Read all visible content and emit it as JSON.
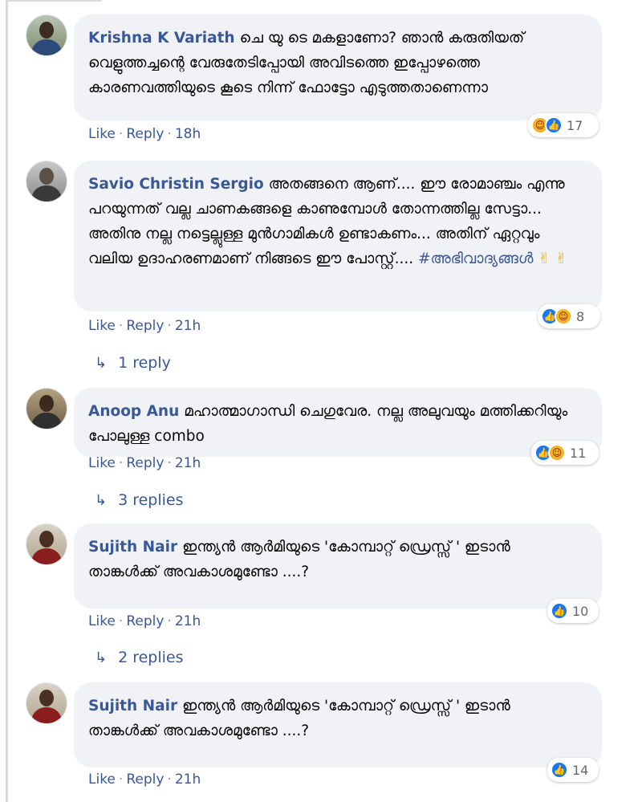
{
  "comments": [
    {
      "author": "Krishna K Variath",
      "text": "ചെ യു ടെ മകളാണോ? ഞാൻ കരുതിയത് വെളുത്തച്ചന്റെ വേരുതേടിപ്പോയി അവിടത്തെ ഇപ്പോഴത്തെ കാരണവത്തിയുടെ കൂടെ നിന്ന് ഫോട്ടോ എടുത്തതാണെന്നാ",
      "reactions": [
        "haha",
        "like"
      ],
      "reaction_count": "17",
      "like_label": "Like",
      "reply_label": "Reply",
      "time": "18h"
    },
    {
      "author": "Savio Christin Sergio",
      "text": "അതങ്ങനെ ആണ്.... ഈ രോമാഞ്ചം എന്നു പറയുന്നത് വല്ല ചാണകങ്ങളെ കാണുമ്പോൾ തോന്നത്തില്ല സേട്ടാ... അതിനു നല്ല നട്ടെല്ലുള്ള മുൻഗാമികൾ ഉണ്ടാകണം... അതിന് ഏറ്റവും വലിയ ഉദാഹരണമാണ് നിങ്ങടെ ഈ പോസ്റ്റ്....",
      "hashtag": "#അഭിവാദ്യങ്ങൾ",
      "emoji": "✌ ✌",
      "reactions": [
        "like",
        "haha"
      ],
      "reaction_count": "8",
      "like_label": "Like",
      "reply_label": "Reply",
      "time": "21h",
      "replies_label": "1 reply"
    },
    {
      "author": "Anoop Anu",
      "text": "മഹാത്മാഗാന്ധി ചെഗുവേര. നല്ല അലുവയും മത്തിക്കറിയും പോലുള്ള combo",
      "reactions": [
        "like",
        "haha"
      ],
      "reaction_count": "11",
      "like_label": "Like",
      "reply_label": "Reply",
      "time": "21h",
      "replies_label": "3 replies"
    },
    {
      "author": "Sujith Nair",
      "text": "ഇന്ത്യൻ ആർമിയുടെ 'കോമ്പാറ്റ് ഡ്രെസ്സ് ' ഇടാൻ താങ്കൾക്ക് അവകാശമുണ്ടോ ....?",
      "reactions": [
        "like"
      ],
      "reaction_count": "10",
      "like_label": "Like",
      "reply_label": "Reply",
      "time": "21h",
      "replies_label": "2 replies"
    },
    {
      "author": "Sujith Nair",
      "text": "ഇന്ത്യൻ ആർമിയുടെ 'കോമ്പാറ്റ് ഡ്രെസ്സ് ' ഇടാൻ താങ്കൾക്ക് അവകാശമുണ്ടോ ....?",
      "reactions": [
        "like"
      ],
      "reaction_count": "14",
      "like_label": "Like",
      "reply_label": "Reply",
      "time": "21h"
    }
  ],
  "icons": {
    "like": "like-reaction-icon",
    "haha": "haha-reaction-icon",
    "reply_arrow": "reply-arrow-icon"
  },
  "colors": {
    "author": "#385898",
    "bubble": "#f0f2f5",
    "like_blue": "#1877f2",
    "haha_yellow": "#f7b125"
  }
}
